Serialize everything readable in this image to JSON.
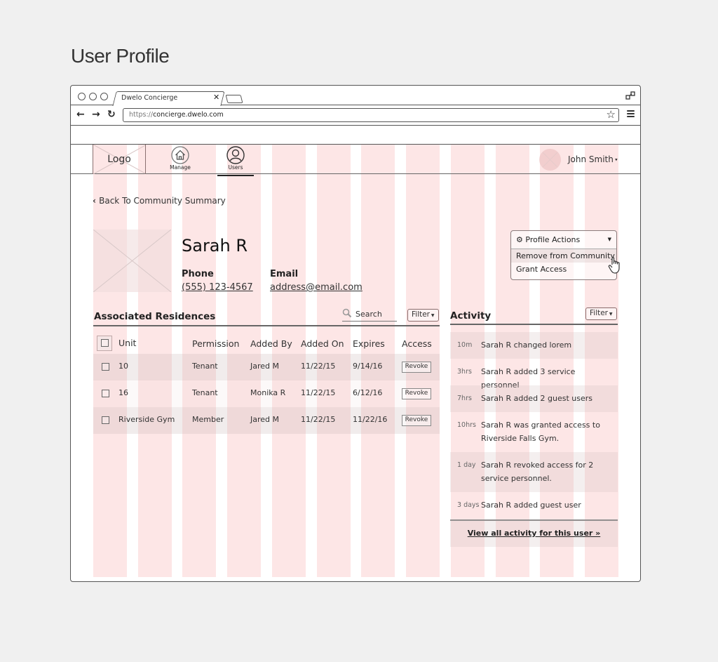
{
  "page_heading": "User Profile",
  "browser": {
    "tab_title": "Dwelo Concierge",
    "url_protocol": "https://",
    "url_host": "concierge.dwelo.com"
  },
  "app_header": {
    "logo_label": "Logo",
    "nav": [
      {
        "label": "Manage",
        "icon": "home-icon",
        "active": false
      },
      {
        "label": "Users",
        "icon": "user-icon",
        "active": true
      }
    ],
    "user_name": "John Smith"
  },
  "back_link": "Back To Community Summary",
  "profile": {
    "name": "Sarah R",
    "phone_label": "Phone",
    "phone": "(555) 123-4567",
    "email_label": "Email",
    "email": "address@email.com"
  },
  "profile_actions": {
    "label": "Profile Actions",
    "items": [
      "Remove from Community",
      "Grant Access"
    ]
  },
  "residences": {
    "title": "Associated Residences",
    "search_placeholder": "Search",
    "filter_label": "Filter",
    "columns": [
      "Unit",
      "Permission",
      "Added By",
      "Added On",
      "Expires",
      "Access"
    ],
    "rows": [
      {
        "unit": "10",
        "permission": "Tenant",
        "added_by": "Jared M",
        "added_on": "11/22/15",
        "expires": "9/14/16",
        "access": "Revoke"
      },
      {
        "unit": "16",
        "permission": "Tenant",
        "added_by": "Monika R",
        "added_on": "11/22/15",
        "expires": "6/12/16",
        "access": "Revoke"
      },
      {
        "unit": "Riverside Gym",
        "permission": "Member",
        "added_by": "Jared M",
        "added_on": "11/22/15",
        "expires": "11/22/16",
        "access": "Revoke"
      }
    ]
  },
  "activity": {
    "title": "Activity",
    "filter_label": "Filter",
    "items": [
      {
        "time": "10m",
        "text": "Sarah R changed lorem"
      },
      {
        "time": "3hrs",
        "text": "Sarah R added 3 service personnel"
      },
      {
        "time": "7hrs",
        "text": "Sarah R added 2 guest users"
      },
      {
        "time": "10hrs",
        "text": "Sarah R was granted access to Riverside Falls Gym."
      },
      {
        "time": "1 day",
        "text": "Sarah R revoked access for 2 service personnel."
      },
      {
        "time": "3 days",
        "text": "Sarah R added guest user"
      }
    ],
    "view_all": "View all activity for this user »"
  }
}
